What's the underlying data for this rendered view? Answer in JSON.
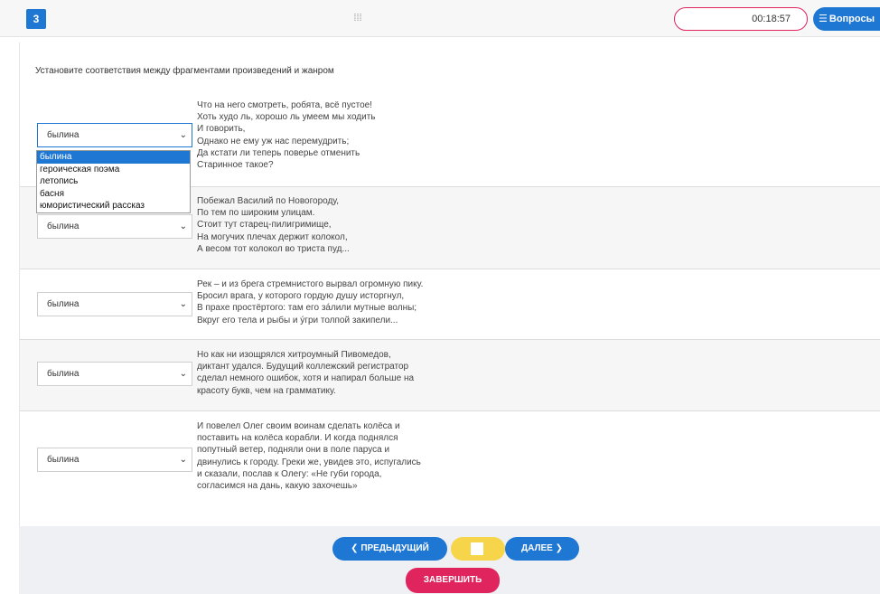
{
  "header": {
    "question_number": "3",
    "menu_icon": "grid-dots-icon",
    "timer": "00:18:57",
    "questions_label": "Вопросы",
    "questions_icon": "stack-icon"
  },
  "instruction": "Установите соответствия между фрагментами произведений и жанром",
  "rows": [
    {
      "selected": "былина",
      "fragment": "Что на него смотреть, робята, всё пустое!\nХоть худо ль, хорошо ль умеем мы ходить\nИ говорить,\nОднако не ему уж нас перемудрить;\nДа кстати ли теперь поверье отменить\nСтаринное такое?"
    },
    {
      "selected": "былина",
      "fragment": "Побежал Василий по Новогороду,\nПо тем по широким улицам.\nСтоит тут старец-пилигримище,\nНа могучих плечах держит колокол,\nА весом тот колокол во триста пуд..."
    },
    {
      "selected": "былина",
      "fragment": "Рек – и из брега стремнистого вырвал огромную пику.\nБросил врага, у которого гордую душу исторгнул,\nВ прахе простёртого: там его зáлили мутные волны;\nВкруг его тела и рыбы и ýгри толпой закипели..."
    },
    {
      "selected": "былина",
      "fragment": "Но как ни изощрялся хитроумный Пивомедов,\nдиктант удался. Будущий коллежский регистратор\nсделал немного ошибок, хотя и напирал больше на\nкрасоту букв, чем на грамматику."
    },
    {
      "selected": "былина",
      "fragment": "И повелел Олег своим воинам сделать колёса и\nпоставить на колёса корабли. И когда поднялся\nпопутный ветер, подняли они в поле паруса и\nдвинулись к городу. Греки же, увидев это, испугались\nи сказали, послав к Олегу: «Не губи города,\nсогласимся на дань, какую захочешь»"
    }
  ],
  "dropdown_options": [
    "былина",
    "героическая поэма",
    "летопись",
    "басня",
    "юмористический рассказ"
  ],
  "footer": {
    "prev_label": "❮ ПРЕДЫДУЩИЙ",
    "next_label": "ДАЛЕЕ ❯",
    "finish_label": "ЗАВЕРШИТЬ"
  },
  "colors": {
    "primary": "#1f77d4",
    "danger": "#e0245e",
    "mark": "#f6d54a"
  }
}
